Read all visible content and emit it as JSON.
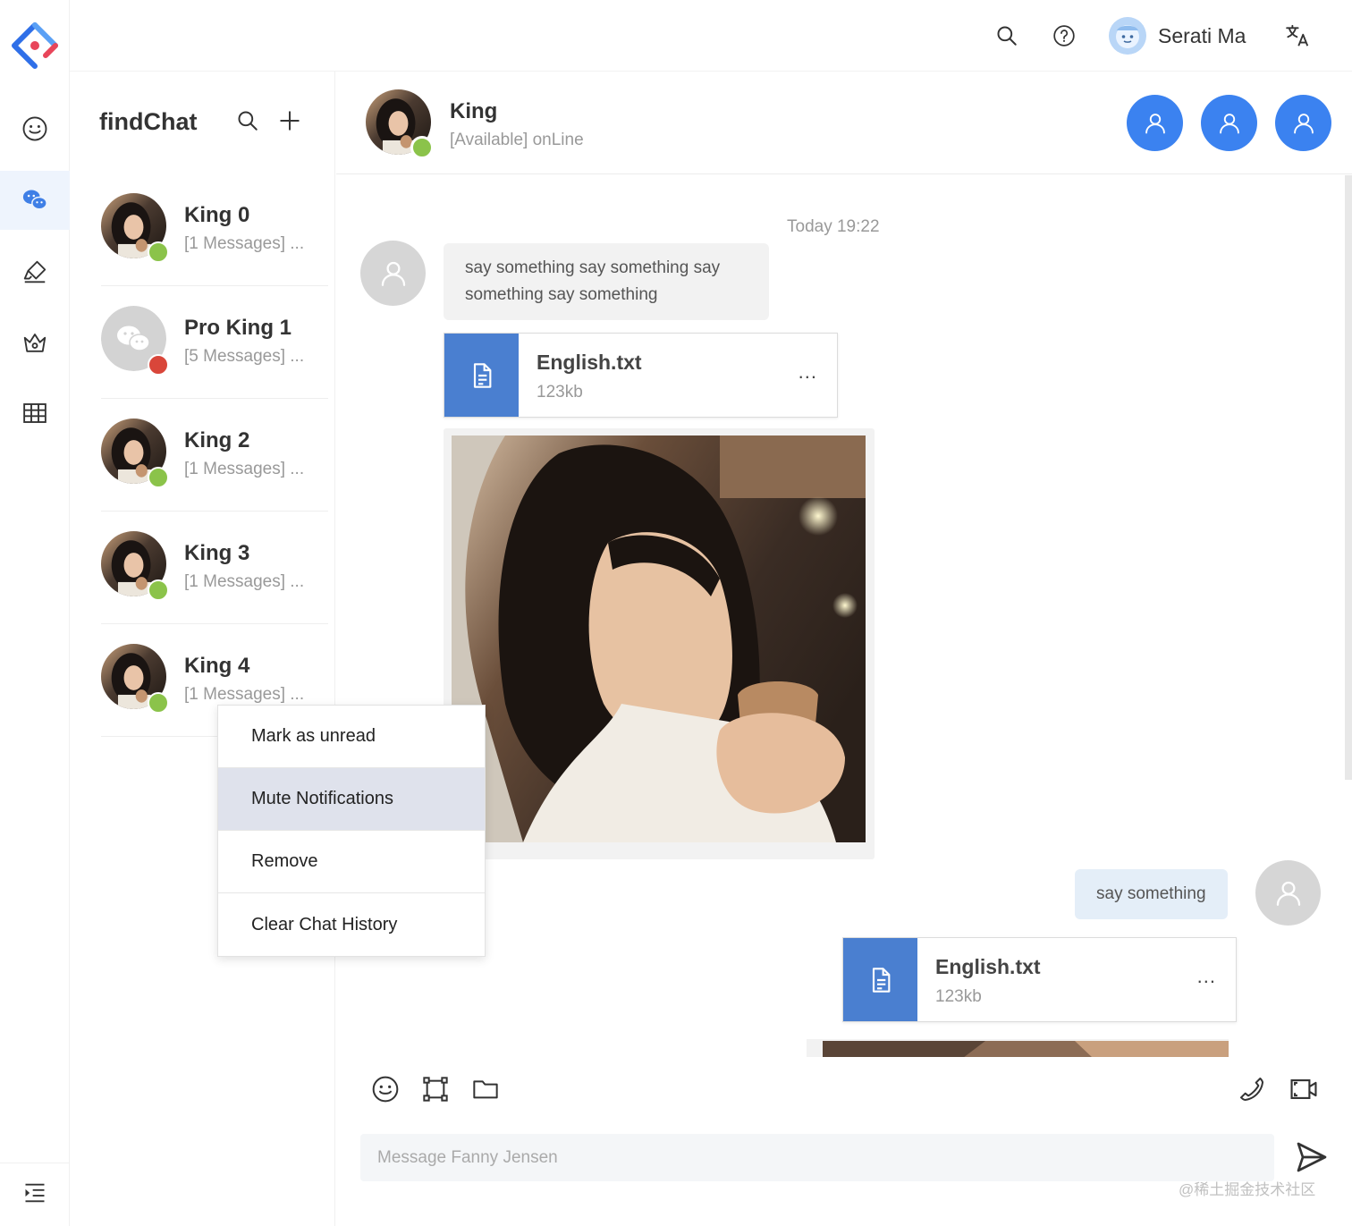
{
  "header": {
    "user_name": "Serati Ma"
  },
  "sidebar": {
    "icons": [
      "app-logo",
      "smile-icon",
      "wechat-icon",
      "highlight-icon",
      "crown-icon",
      "table-icon",
      "menu-indent-icon"
    ]
  },
  "chat_list": {
    "title": "findChat",
    "items": [
      {
        "name": "King 0",
        "preview": "[1 Messages] ...",
        "status": "online"
      },
      {
        "name": "Pro King 1",
        "preview": "[5 Messages] ...",
        "status": "busy"
      },
      {
        "name": "King 2",
        "preview": "[1 Messages] ...",
        "status": "online"
      },
      {
        "name": "King 3",
        "preview": "[1 Messages] ...",
        "status": "online"
      },
      {
        "name": "King 4",
        "preview": "[1 Messages] ...",
        "status": "online"
      }
    ]
  },
  "context_menu": {
    "items": [
      "Mark as unread",
      "Mute Notifications",
      "Remove",
      "Clear Chat History"
    ],
    "highlighted": "Mute Notifications"
  },
  "chat": {
    "contact_name": "King",
    "contact_status": "[Available] onLine",
    "timestamp": "Today 19:22",
    "incoming_text": "say something say something say something say something",
    "incoming_file": {
      "name": "English.txt",
      "size": "123kb",
      "more": "..."
    },
    "outgoing_text": "say something",
    "outgoing_file": {
      "name": "English.txt",
      "size": "123kb",
      "more": "..."
    }
  },
  "composer": {
    "placeholder": "Message Fanny Jensen"
  },
  "watermark": "@稀土掘金技术社区",
  "colors": {
    "accent": "#3b82f0",
    "file_icon_bg": "#4a7fd0",
    "online": "#8bc34a",
    "busy": "#d9463a",
    "menu_highlight": "#dfe2ec",
    "active_nav_bg": "#eef4fd"
  }
}
